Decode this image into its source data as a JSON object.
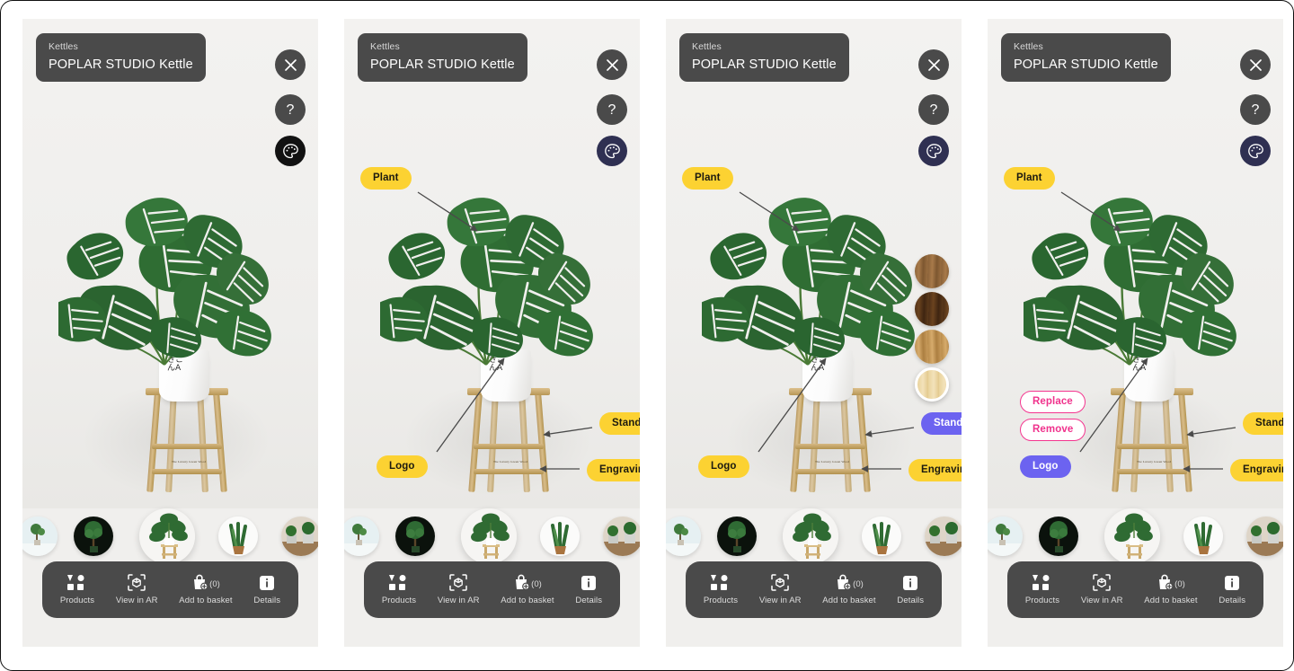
{
  "header": {
    "subtitle": "Kettles",
    "title": "POPLAR STUDIO  Kettle",
    "close_icon": "close-icon",
    "help_icon": "help-icon",
    "palette_icon": "palette-icon"
  },
  "scene": {
    "pot_logo_line1": "きこ",
    "pot_logo_line2": "んA",
    "engraving_text": "The Luxury Green Wood"
  },
  "annotations": {
    "plant": "Plant",
    "stand": "Stand",
    "logo": "Logo",
    "engraving": "Engraving",
    "replace": "Replace",
    "remove": "Remove"
  },
  "colors": {
    "pill_yellow": "#fcd232",
    "pill_purple": "#6c63f0",
    "pill_pink": "#f4358f",
    "panel_bg": "#f0efed",
    "bar_bg": "#4a4a4a",
    "palette_dark": "#121212",
    "palette_navy": "#2f3052"
  },
  "swatches": [
    {
      "name": "walnut",
      "selected": false
    },
    {
      "name": "dark-walnut",
      "selected": false
    },
    {
      "name": "oak",
      "selected": false
    },
    {
      "name": "natural-birch",
      "selected": true
    }
  ],
  "thumbnails": [
    {
      "name": "bonsai",
      "selected": false
    },
    {
      "name": "topiary-tree",
      "selected": false
    },
    {
      "name": "monstera-on-stand",
      "selected": true
    },
    {
      "name": "snake-plant",
      "selected": false
    },
    {
      "name": "potted-plants",
      "selected": false
    }
  ],
  "toolbar": [
    {
      "label": "Products",
      "icon": "grid-icon",
      "count": null
    },
    {
      "label": "View in AR",
      "icon": "ar-cube-icon",
      "count": null
    },
    {
      "label": "Add to basket",
      "icon": "basket-icon",
      "count": "(0)"
    },
    {
      "label": "Details",
      "icon": "info-icon",
      "count": null
    }
  ],
  "panels": [
    {
      "name": "panel-plain",
      "show_annotations": false,
      "show_swatches": false,
      "selected_pill": null,
      "show_edit_actions": false,
      "palette": "dark"
    },
    {
      "name": "panel-annotated",
      "show_annotations": true,
      "show_swatches": false,
      "selected_pill": null,
      "show_edit_actions": false,
      "palette": "navy"
    },
    {
      "name": "panel-stand-picked",
      "show_annotations": true,
      "show_swatches": true,
      "selected_pill": "stand",
      "show_edit_actions": false,
      "palette": "navy"
    },
    {
      "name": "panel-logo-picked",
      "show_annotations": true,
      "show_swatches": false,
      "selected_pill": "logo",
      "show_edit_actions": true,
      "palette": "navy"
    }
  ]
}
